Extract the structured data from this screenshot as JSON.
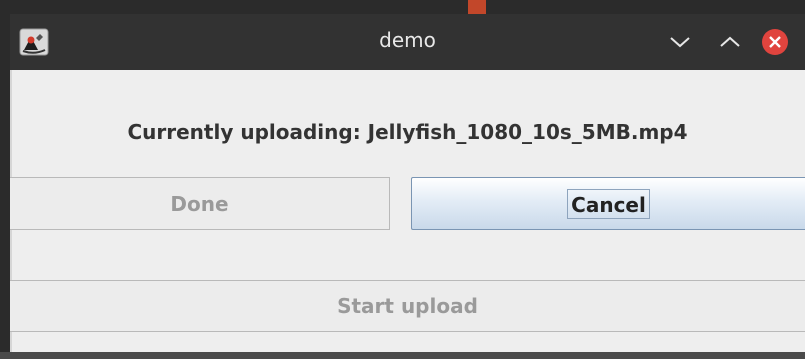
{
  "window": {
    "title": "demo",
    "icon": "java-duke-icon",
    "controls": {
      "minimize_icon": "chevron-down-icon",
      "maximize_icon": "chevron-up-icon",
      "close_icon": "close-icon",
      "close_color": "#e0443e"
    }
  },
  "main": {
    "message": "Currently uploading: Jellyfish_1080_10s_5MB.mp4",
    "done_label": "Done",
    "cancel_label": "Cancel",
    "start_upload_label": "Start upload"
  }
}
